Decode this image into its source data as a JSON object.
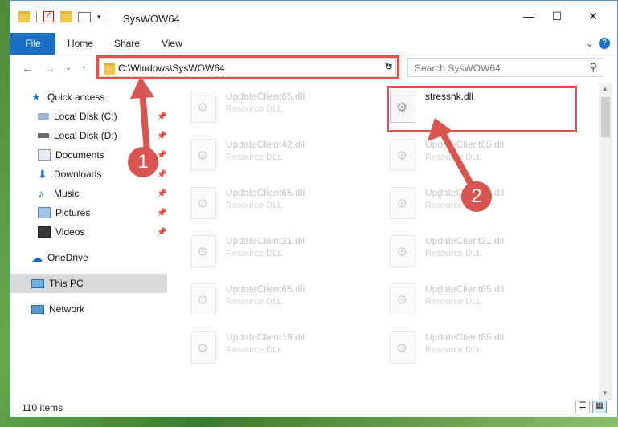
{
  "window": {
    "title": "SysWOW64",
    "controls": {
      "minimize": "—",
      "maximize": "☐",
      "close": "✕"
    }
  },
  "ribbon": {
    "tabs": [
      "File",
      "Home",
      "Share",
      "View"
    ],
    "help": "?"
  },
  "navigation": {
    "back": "←",
    "forward": "→",
    "recent": "⌄",
    "up": "↑",
    "address": "C:\\Windows\\SysWOW64",
    "search_placeholder": "Search SysWOW64"
  },
  "sidebar": {
    "items": [
      {
        "label": "Quick access",
        "icon": "star-icon",
        "pinned": false
      },
      {
        "label": "Local Disk (C:)",
        "icon": "drive-icon",
        "pinned": true
      },
      {
        "label": "Local Disk (D:)",
        "icon": "drive-icon",
        "pinned": true
      },
      {
        "label": "Documents",
        "icon": "documents-icon",
        "pinned": true
      },
      {
        "label": "Downloads",
        "icon": "download-icon",
        "pinned": true
      },
      {
        "label": "Music",
        "icon": "music-icon",
        "pinned": true
      },
      {
        "label": "Pictures",
        "icon": "pictures-icon",
        "pinned": true
      },
      {
        "label": "Videos",
        "icon": "videos-icon",
        "pinned": true
      },
      {
        "label": "OneDrive",
        "icon": "cloud-icon",
        "pinned": false
      },
      {
        "label": "This PC",
        "icon": "computer-icon",
        "pinned": false,
        "selected": true
      },
      {
        "label": "Network",
        "icon": "network-icon",
        "pinned": false
      }
    ]
  },
  "files": {
    "left": [
      {
        "name": "UpdateClient65.dll",
        "type": "Resource DLL"
      },
      {
        "name": "UpdateClient42.dll",
        "type": "Resource DLL"
      },
      {
        "name": "UpdateClient65.dll",
        "type": "Resource DLL"
      },
      {
        "name": "UpdateClient21.dll",
        "type": "Resource DLL"
      },
      {
        "name": "UpdateClient65.dll",
        "type": "Resource DLL"
      },
      {
        "name": "UpdateClient19.dll",
        "type": "Resource DLL"
      }
    ],
    "right": [
      {
        "name": "stresshk.dll",
        "type": "",
        "highlighted": true
      },
      {
        "name": "UpdateClient65.dll",
        "type": "Resource DLL"
      },
      {
        "name": "UpdateClient65.dll",
        "type": "Resource DLL"
      },
      {
        "name": "UpdateClient21.dll",
        "type": "Resource DLL"
      },
      {
        "name": "UpdateClient65.dll",
        "type": "Resource DLL"
      },
      {
        "name": "UpdateClient65.dll",
        "type": "Resource DLL"
      }
    ]
  },
  "annotations": {
    "badge1": "1",
    "badge2": "2",
    "accent": "#d9534f"
  },
  "status": {
    "item_count": "110 items"
  }
}
